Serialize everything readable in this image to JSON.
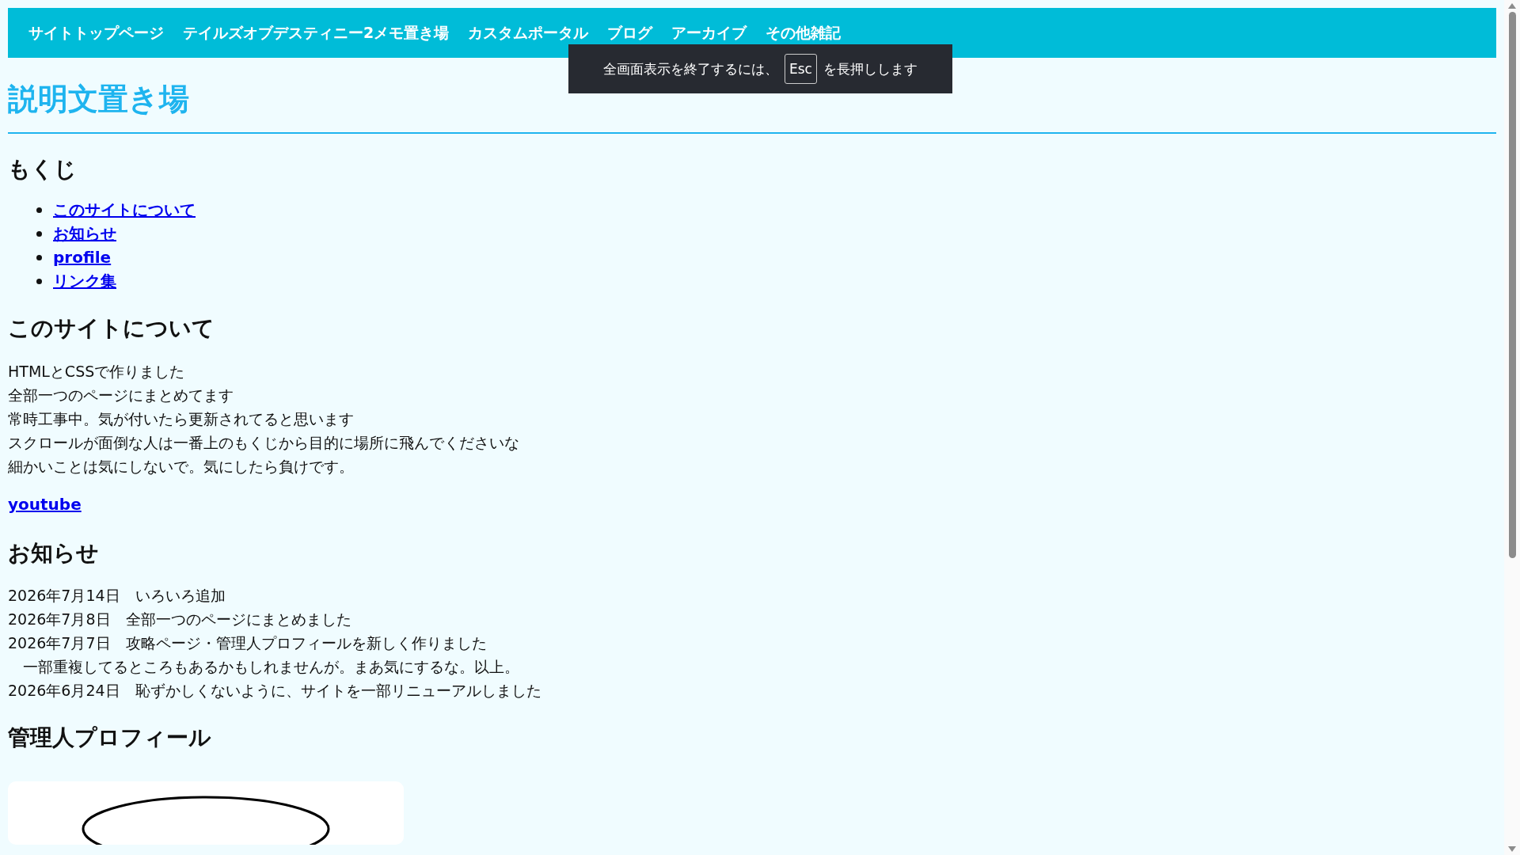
{
  "nav": [
    "サイトトップページ",
    "テイルズオブデスティニー2メモ置き場",
    "カスタムポータル",
    "ブログ",
    "アーカイブ",
    "その他雑記"
  ],
  "fullscreen_notice": {
    "before": "全画面表示を終了するには、",
    "key": "Esc",
    "after": "を長押しします"
  },
  "title": "説明文置き場",
  "toc": {
    "heading": "もくじ",
    "items": [
      "このサイトについて",
      "お知らせ",
      "profile",
      "リンク集"
    ]
  },
  "about": {
    "heading": "このサイトについて",
    "lines": [
      "HTMLとCSSで作りました",
      "全部一つのページにまとめてます",
      "常時工事中。気が付いたら更新されてると思います",
      "スクロールが面倒な人は一番上のもくじから目的に場所に飛んでくださいな",
      "細かいことは気にしないで。気にしたら負けです。"
    ],
    "link": "youtube"
  },
  "news": {
    "heading": "お知らせ",
    "entries": [
      "2026年7月14日　いろいろ追加",
      "2026年7月8日　全部一つのページにまとめました",
      "2026年7月7日　攻略ページ・管理人プロフィールを新しく作りました",
      "　一部重複してるところもあるかもしれませんが。まあ気にするな。以上。",
      "2026年6月24日　恥ずかしくないように、サイトを一部リニューアルしました"
    ]
  },
  "profile": {
    "heading": "管理人プロフィール"
  }
}
